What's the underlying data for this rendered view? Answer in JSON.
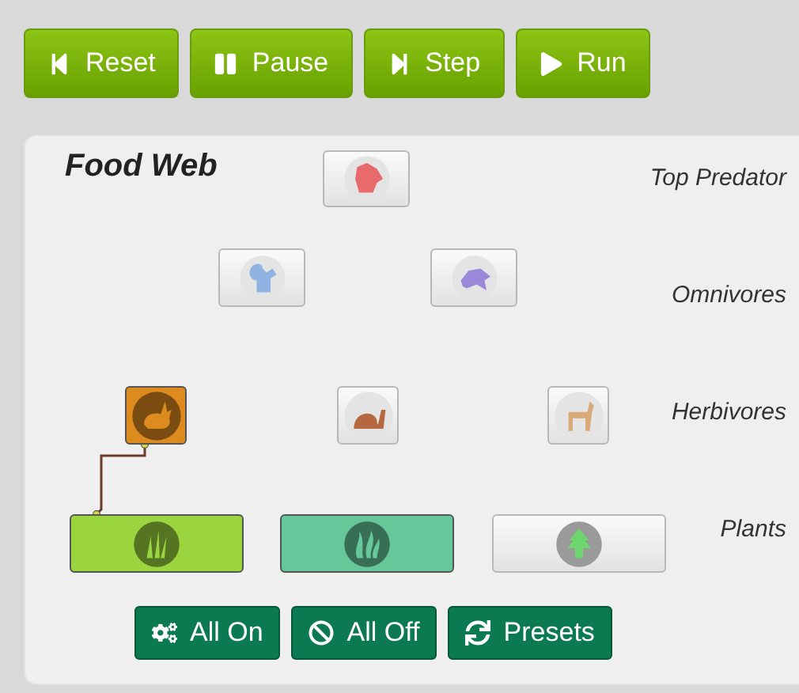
{
  "toolbar": [
    {
      "kind": "reset",
      "label": "Reset"
    },
    {
      "kind": "pause",
      "label": "Pause"
    },
    {
      "kind": "step",
      "label": "Step"
    },
    {
      "kind": "run",
      "label": "Run"
    }
  ],
  "panel": {
    "title": "Food Web",
    "levels": [
      {
        "label": "Top Predator",
        "organisms": [
          {
            "kind": "wolf",
            "active": false,
            "linked": false,
            "color": "#e86a6a"
          }
        ]
      },
      {
        "label": "Omnivores",
        "organisms": [
          {
            "kind": "squirrel",
            "active": false,
            "linked": false,
            "color": "#8fb4e3"
          },
          {
            "kind": "raccoon",
            "active": false,
            "linked": false,
            "color": "#9a88d8"
          }
        ]
      },
      {
        "label": "Herbivores",
        "organisms": [
          {
            "kind": "rabbit",
            "active": true,
            "linked": true,
            "color": "#dd8a1f"
          },
          {
            "kind": "snail",
            "active": false,
            "linked": false,
            "color": "#b5683f"
          },
          {
            "kind": "deer",
            "active": false,
            "linked": false,
            "color": "#d9aa78"
          }
        ]
      },
      {
        "label": "Plants",
        "organisms": [
          {
            "kind": "grass",
            "active": true,
            "linked": true,
            "color": "#9ad43f"
          },
          {
            "kind": "seaweed",
            "active": true,
            "linked": false,
            "color": "#66c89a"
          },
          {
            "kind": "tree",
            "active": false,
            "linked": false,
            "color": "#6ed66e"
          }
        ]
      }
    ],
    "actions": [
      {
        "kind": "all-on",
        "label": "All On"
      },
      {
        "kind": "all-off",
        "label": "All Off"
      },
      {
        "kind": "presets",
        "label": "Presets"
      }
    ]
  }
}
